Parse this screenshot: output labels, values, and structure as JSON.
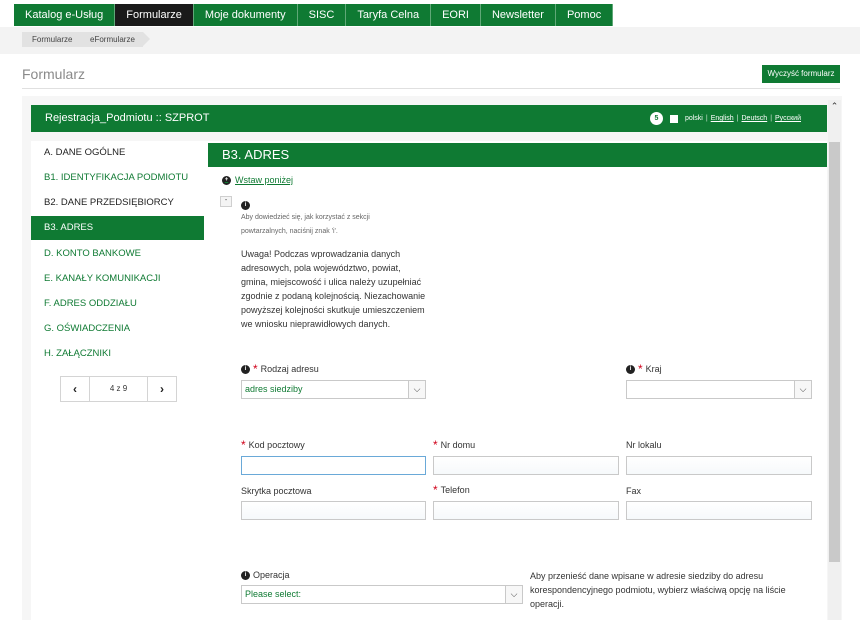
{
  "nav": {
    "items": [
      {
        "label": "Katalog e-Usług",
        "active": false
      },
      {
        "label": "Formularze",
        "active": true
      },
      {
        "label": "Moje dokumenty",
        "active": false
      },
      {
        "label": "SISC",
        "active": false
      },
      {
        "label": "Taryfa Celna",
        "active": false
      },
      {
        "label": "EORI",
        "active": false
      },
      {
        "label": "Newsletter",
        "active": false
      },
      {
        "label": "Pomoc",
        "active": false
      }
    ]
  },
  "breadcrumb": [
    "Formularze",
    "eFormularze"
  ],
  "page": {
    "title": "Formularz",
    "clear_button": "Wyczyść formularz"
  },
  "form": {
    "name": "Rejestracja_Podmiotu :: SZPROT",
    "badge_count": "5",
    "languages": [
      "polski",
      "English",
      "Deutsch",
      "Русский"
    ]
  },
  "sidebar": {
    "items": [
      {
        "label": "A. DANE OGÓLNE",
        "state": "plain"
      },
      {
        "label": "B1. IDENTYFIKACJA PODMIOTU",
        "state": "link"
      },
      {
        "label": "B2. DANE PRZEDSIĘBIORCY",
        "state": "plain"
      },
      {
        "label": "B3. ADRES",
        "state": "active"
      },
      {
        "label": "D. KONTO BANKOWE",
        "state": "link"
      },
      {
        "label": "E. KANAŁY KOMUNIKACJI",
        "state": "link"
      },
      {
        "label": "F. ADRES ODDZIAŁU",
        "state": "link"
      },
      {
        "label": "G. OŚWIADCZENIA",
        "state": "link"
      },
      {
        "label": "H. ZAŁĄCZNIKI",
        "state": "link"
      }
    ],
    "pager": {
      "prev": "‹",
      "count": "4 z 9",
      "next": "›"
    }
  },
  "section": {
    "title": "B3. ADRES",
    "insert_link": "Wstaw poniżej",
    "toggle": "-",
    "hint": "Aby dowiedzieć się, jak korzystać z sekcji powtarzalnych, naciśnij znak 'i'.",
    "warning": "Uwaga! Podczas wprowadzania danych adresowych, pola województwo, powiat, gmina, miejscowość i ulica należy uzupełniać zgodnie z podaną kolejnością. Niezachowanie powyższej kolejności skutkuje umieszczeniem we wniosku nieprawidłowych danych."
  },
  "fields": {
    "address_type": {
      "label": "Rodzaj adresu",
      "value": "adres siedziby"
    },
    "country": {
      "label": "Kraj",
      "value": ""
    },
    "postal_code": {
      "label": "Kod pocztowy",
      "value": ""
    },
    "house_number": {
      "label": "Nr domu",
      "value": ""
    },
    "apartment_number": {
      "label": "Nr lokalu",
      "value": ""
    },
    "po_box": {
      "label": "Skrytka pocztowa",
      "value": ""
    },
    "phone": {
      "label": "Telefon",
      "value": ""
    },
    "fax": {
      "label": "Fax",
      "value": ""
    },
    "operation": {
      "label": "Operacja",
      "value": "Please select:"
    }
  },
  "operation_note": "Aby przenieść dane wpisane w adresie siedziby do adresu korespondencyjnego podmiotu, wybierz właściwą opcję na liście operacji.",
  "icons": {
    "info": "i",
    "dropdown": "⌵",
    "scroll_up": "⌃"
  },
  "colors": {
    "brand_green": "#0f7a33",
    "active_nav": "#1a1a1a",
    "required": "#d0021b"
  }
}
